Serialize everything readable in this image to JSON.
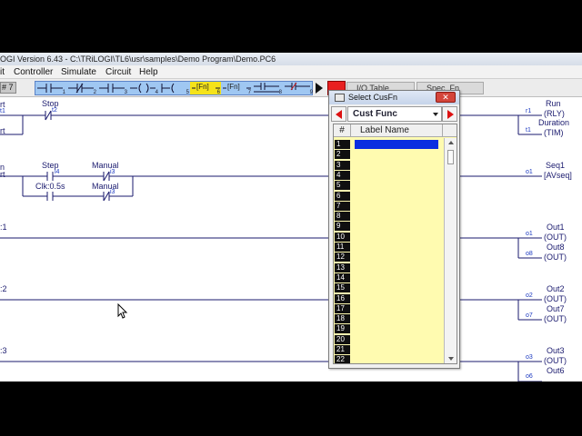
{
  "window": {
    "title": "OGI Version 6.43 - C:\\TRiLOGI\\TL6\\usr\\samples\\Demo Program\\Demo.PC6"
  },
  "menu": {
    "items": [
      "it",
      "Controller",
      "Simulate",
      "Circuit",
      "Help"
    ]
  },
  "toolbar": {
    "circuit_number": "# 7",
    "button_subscripts": [
      "1",
      "2",
      "3",
      "4",
      "5",
      "6",
      "7",
      "8",
      "9",
      "0"
    ],
    "fn_label": "[Fn]",
    "tabs": [
      "I/O Table",
      "Spec. Fn"
    ]
  },
  "ladder": {
    "left_partials": [
      "rt",
      "t1",
      "rt",
      "n",
      "rt"
    ],
    "rung1": {
      "contact_label": "Stop",
      "contact_addr": "t2",
      "coil_addr1": "r1",
      "coil_name1": "Run",
      "coil_type1": "(RLY)",
      "coil_addr2": "t1",
      "coil_name2": "Duration",
      "coil_type2": "(TIM)"
    },
    "rung2": {
      "contacts": [
        {
          "label": "Step",
          "addr": "i4"
        },
        {
          "label": "Manual",
          "addr": "i3"
        },
        {
          "label": "Clk:0.5s",
          "addr": ""
        },
        {
          "label": "Manual",
          "addr": "i3"
        }
      ],
      "coil_addr": "o1",
      "coil_name": "Seq1",
      "coil_type": "[AVseq]"
    },
    "rung3": {
      "label": ":1",
      "coils": [
        {
          "addr": "o1",
          "name": "Out1",
          "type": "(OUT)"
        },
        {
          "addr": "o8",
          "name": "Out8",
          "type": "(OUT)"
        }
      ]
    },
    "rung4": {
      "label": ":2",
      "coils": [
        {
          "addr": "o2",
          "name": "Out2",
          "type": "(OUT)"
        },
        {
          "addr": "o7",
          "name": "Out7",
          "type": "(OUT)"
        }
      ]
    },
    "rung5": {
      "label": ":3",
      "coils": [
        {
          "addr": "o3",
          "name": "Out3",
          "type": "(OUT)"
        },
        {
          "addr": "o6",
          "name": "Out6",
          "type": "(OUT)"
        }
      ]
    }
  },
  "dialog": {
    "title": "Select CusFn",
    "close_label": "✕",
    "select_value": "Cust Func",
    "col_num": "#",
    "col_label": "Label Name",
    "rows": [
      "1",
      "2",
      "3",
      "4",
      "5",
      "6",
      "7",
      "8",
      "9",
      "10",
      "11",
      "12",
      "13",
      "14",
      "15",
      "16",
      "17",
      "18",
      "19",
      "20",
      "21",
      "22"
    ]
  },
  "colors": {
    "accent": "#0a2ee0",
    "toolbar_strip": "#9fc7f2",
    "fn_highlight": "#f5e31a",
    "table_bg": "#fffbb0",
    "ladder_text": "#1a1a6e"
  }
}
